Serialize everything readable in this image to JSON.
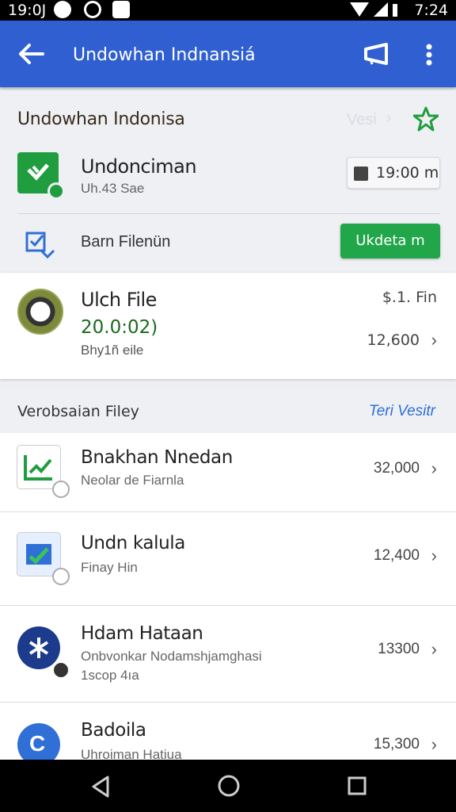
{
  "status_bar": {
    "time_left": "19:0J",
    "time_right": "7:24"
  },
  "app_bar": {
    "title": "Undowhan Indnansiá"
  },
  "header_card": {
    "section_title": "Undowhan Indonisa",
    "ghost_text": "Vesi",
    "app_row": {
      "title": "Undonciman",
      "subtitle": "Uh.43 Sae",
      "time_button": "19:00 m"
    },
    "action_row": {
      "label": "Barn Filenün",
      "button": "Ukdeta m"
    }
  },
  "file_card": {
    "title": "Ulch File",
    "amount": "20.0:02)",
    "subtitle": "Bhy1ñ eile",
    "top_right": "$.1. Fin",
    "value": "12,600"
  },
  "section2": {
    "title": "Verobsaian Filey",
    "link": "Teri Vesitr"
  },
  "list": [
    {
      "title": "Bnakhan Nnedan",
      "subtitle": "Neolar de Fiarnla",
      "subtitle2": "",
      "value": "32,000"
    },
    {
      "title": "Undn kalula",
      "subtitle": "Finay Hin",
      "subtitle2": "",
      "value": "12,400"
    },
    {
      "title": "Hdam Hataan",
      "subtitle": "Onbvonkar Nodamshjamghasi",
      "subtitle2": "1scop 4ıa",
      "value": "13300"
    },
    {
      "title": "Badoila",
      "subtitle": "Uhroiman Hatiua",
      "subtitle2": "",
      "value": "15,300"
    }
  ],
  "colors": {
    "app_bar": "#2f5fd0",
    "accent_green": "#22a64a",
    "link_blue": "#2f6fd6"
  }
}
